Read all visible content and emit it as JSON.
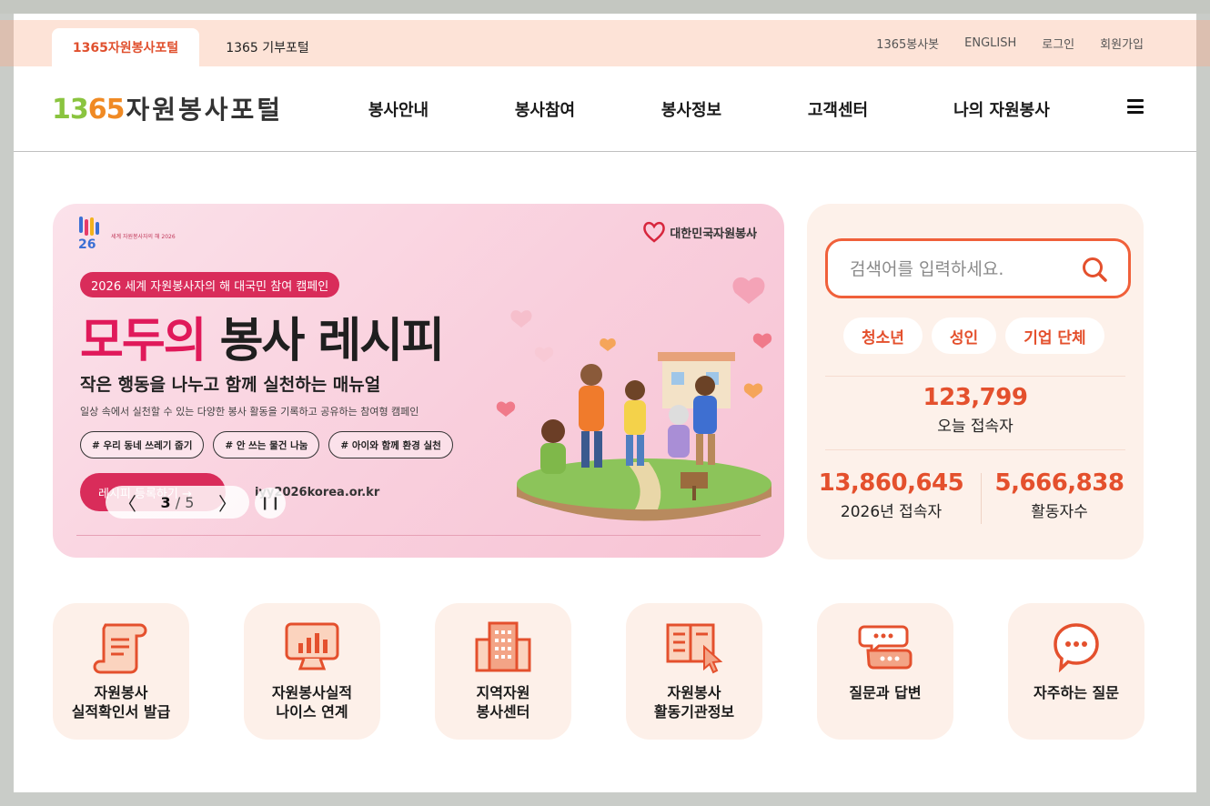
{
  "utility": {
    "tabs": [
      "1365자원봉사포털",
      "1365 기부포털"
    ],
    "links": [
      "1365봉사봇",
      "ENGLISH",
      "로그인",
      "회원가입"
    ]
  },
  "header": {
    "logo_num": "1365",
    "logo_text": "자원봉사포털",
    "nav": [
      "봉사안내",
      "봉사참여",
      "봉사정보",
      "고객센터",
      "나의 자원봉사"
    ]
  },
  "banner": {
    "small_logo_text": "세계 자원봉사자의 해 2026",
    "brand_small": "KOREA VOLUNTEER",
    "brand": "대한민국자원봉사",
    "pill": "2026 세계 자원봉사자의 해 대국민 참여 캠페인",
    "title_red": "모두의",
    "title_dark": " 봉사 레시피",
    "subtitle": "작은 행동을 나누고 함께 실천하는 매뉴얼",
    "description": "일상 속에서 실천할 수 있는 다양한 봉사 활동을 기록하고 공유하는 참여형 캠페인",
    "tags": [
      "# 우리 동네 쓰레기 줍기",
      "# 안 쓰는 물건 나눔",
      "# 아이와 함께 환경 실천"
    ],
    "cta": "레시피 등록하기 →",
    "url": "iyy2026korea.or.kr",
    "current_slide": "3",
    "total_slides": "/ 5",
    "prev_symbol": "〈",
    "next_symbol": "〉",
    "pause_symbol": "❙❙"
  },
  "side": {
    "search_placeholder": "검색어를 입력하세요.",
    "chips": [
      "청소년",
      "성인",
      "기업 단체"
    ],
    "today_count": "123,799",
    "today_label": "오늘 접속자",
    "year_count": "13,860,645",
    "year_label": "2026년 접속자",
    "active_count": "5,666,838",
    "active_label": "활동자수"
  },
  "quick": [
    {
      "label": "자원봉사\n실적확인서 발급",
      "icon": "certificate-scroll-icon"
    },
    {
      "label": "자원봉사실적\n나이스 연계",
      "icon": "monitor-chart-icon"
    },
    {
      "label": "지역자원\n봉사센터",
      "icon": "building-icon"
    },
    {
      "label": "자원봉사\n활동기관정보",
      "icon": "book-cursor-icon"
    },
    {
      "label": "질문과 답변",
      "icon": "chat-bubbles-icon"
    },
    {
      "label": "자주하는 질문",
      "icon": "speech-bubble-icon"
    }
  ],
  "colors": {
    "accent": "#e4502d",
    "util_bar": "#fde3d7",
    "panel": "#fdf1ea",
    "banner_pink": "#d92c5a"
  }
}
